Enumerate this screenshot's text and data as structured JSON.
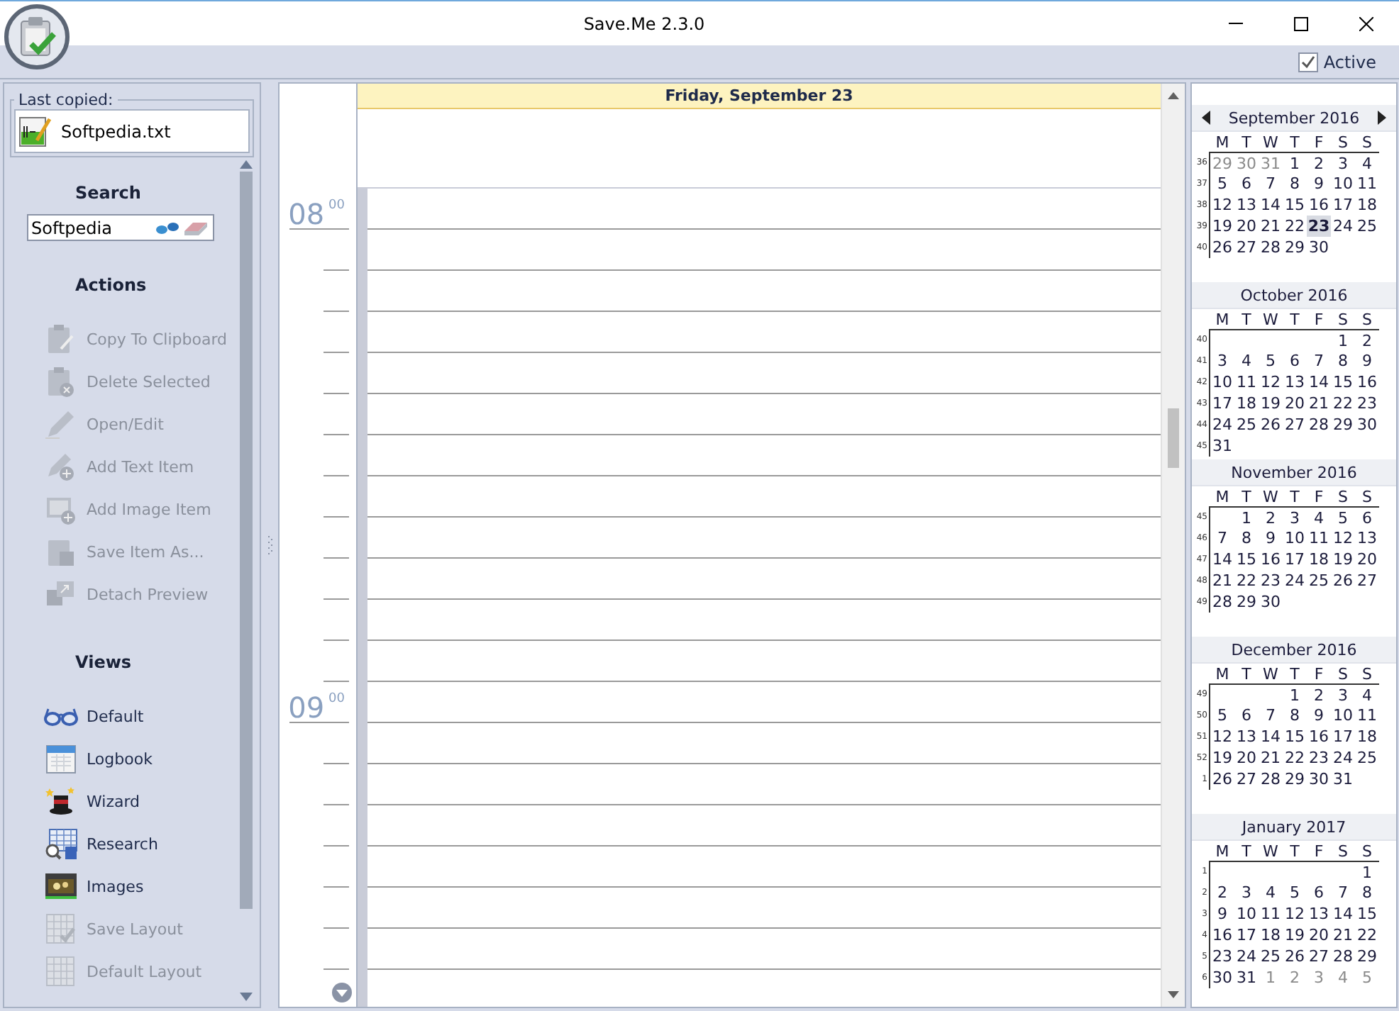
{
  "window": {
    "title": "Save.Me 2.3.0"
  },
  "toolbar": {
    "active": {
      "label": "Active",
      "checked": true
    }
  },
  "last_copied": {
    "label": "Last copied:",
    "file": "Softpedia.txt"
  },
  "sidebar": {
    "search": {
      "heading": "Search",
      "value": "Softpedia"
    },
    "sections": [
      {
        "heading": "Actions",
        "items": [
          {
            "label": "Copy To Clipboard",
            "disabled": true
          },
          {
            "label": "Delete Selected",
            "disabled": true
          },
          {
            "label": "Open/Edit",
            "disabled": true
          },
          {
            "label": "Add Text Item",
            "disabled": true
          },
          {
            "label": "Add Image Item",
            "disabled": true
          },
          {
            "label": "Save Item As...",
            "disabled": true
          },
          {
            "label": "Detach Preview",
            "disabled": true
          }
        ]
      },
      {
        "heading": "Views",
        "items": [
          {
            "label": "Default",
            "disabled": false
          },
          {
            "label": "Logbook",
            "disabled": false
          },
          {
            "label": "Wizard",
            "disabled": false
          },
          {
            "label": "Research",
            "disabled": false
          },
          {
            "label": "Images",
            "disabled": false
          },
          {
            "label": "Save Layout",
            "disabled": true
          },
          {
            "label": "Default Layout",
            "disabled": true
          }
        ]
      }
    ]
  },
  "day_view": {
    "header": "Friday, September 23",
    "hours": [
      {
        "hour": "08",
        "minutes": "00"
      },
      {
        "hour": "09",
        "minutes": "00"
      }
    ]
  },
  "calendar": {
    "months": [
      {
        "title": "September 2016",
        "weekdays": [
          "M",
          "T",
          "W",
          "T",
          "F",
          "S",
          "S"
        ],
        "weeks": [
          {
            "week": "36",
            "days": [
              {
                "day": "29",
                "muted": true,
                "selected": false
              },
              {
                "day": "30",
                "muted": true,
                "selected": false
              },
              {
                "day": "31",
                "muted": true,
                "selected": false
              },
              {
                "day": "1",
                "muted": false,
                "selected": false
              },
              {
                "day": "2",
                "muted": false,
                "selected": false
              },
              {
                "day": "3",
                "muted": false,
                "selected": false
              },
              {
                "day": "4",
                "muted": false,
                "selected": false
              }
            ]
          },
          {
            "week": "37",
            "days": [
              {
                "day": "5",
                "muted": false,
                "selected": false
              },
              {
                "day": "6",
                "muted": false,
                "selected": false
              },
              {
                "day": "7",
                "muted": false,
                "selected": false
              },
              {
                "day": "8",
                "muted": false,
                "selected": false
              },
              {
                "day": "9",
                "muted": false,
                "selected": false
              },
              {
                "day": "10",
                "muted": false,
                "selected": false
              },
              {
                "day": "11",
                "muted": false,
                "selected": false
              }
            ]
          },
          {
            "week": "38",
            "days": [
              {
                "day": "12",
                "muted": false,
                "selected": false
              },
              {
                "day": "13",
                "muted": false,
                "selected": false
              },
              {
                "day": "14",
                "muted": false,
                "selected": false
              },
              {
                "day": "15",
                "muted": false,
                "selected": false
              },
              {
                "day": "16",
                "muted": false,
                "selected": false
              },
              {
                "day": "17",
                "muted": false,
                "selected": false
              },
              {
                "day": "18",
                "muted": false,
                "selected": false
              }
            ]
          },
          {
            "week": "39",
            "days": [
              {
                "day": "19",
                "muted": false,
                "selected": false
              },
              {
                "day": "20",
                "muted": false,
                "selected": false
              },
              {
                "day": "21",
                "muted": false,
                "selected": false
              },
              {
                "day": "22",
                "muted": false,
                "selected": false
              },
              {
                "day": "23",
                "muted": false,
                "selected": true
              },
              {
                "day": "24",
                "muted": false,
                "selected": false
              },
              {
                "day": "25",
                "muted": false,
                "selected": false
              }
            ]
          },
          {
            "week": "40",
            "days": [
              {
                "day": "26",
                "muted": false,
                "selected": false
              },
              {
                "day": "27",
                "muted": false,
                "selected": false
              },
              {
                "day": "28",
                "muted": false,
                "selected": false
              },
              {
                "day": "29",
                "muted": false,
                "selected": false
              },
              {
                "day": "30",
                "muted": false,
                "selected": false
              }
            ]
          }
        ]
      },
      {
        "title": "October 2016",
        "weekdays": [
          "M",
          "T",
          "W",
          "T",
          "F",
          "S",
          "S"
        ],
        "weeks": [
          {
            "week": "40",
            "days": [
              {
                "day": "1",
                "muted": false,
                "selected": false
              },
              {
                "day": "2",
                "muted": false,
                "selected": false
              }
            ]
          },
          {
            "week": "41",
            "days": [
              {
                "day": "3",
                "muted": false,
                "selected": false
              },
              {
                "day": "4",
                "muted": false,
                "selected": false
              },
              {
                "day": "5",
                "muted": false,
                "selected": false
              },
              {
                "day": "6",
                "muted": false,
                "selected": false
              },
              {
                "day": "7",
                "muted": false,
                "selected": false
              },
              {
                "day": "8",
                "muted": false,
                "selected": false
              },
              {
                "day": "9",
                "muted": false,
                "selected": false
              }
            ]
          },
          {
            "week": "42",
            "days": [
              {
                "day": "10",
                "muted": false,
                "selected": false
              },
              {
                "day": "11",
                "muted": false,
                "selected": false
              },
              {
                "day": "12",
                "muted": false,
                "selected": false
              },
              {
                "day": "13",
                "muted": false,
                "selected": false
              },
              {
                "day": "14",
                "muted": false,
                "selected": false
              },
              {
                "day": "15",
                "muted": false,
                "selected": false
              },
              {
                "day": "16",
                "muted": false,
                "selected": false
              }
            ]
          },
          {
            "week": "43",
            "days": [
              {
                "day": "17",
                "muted": false,
                "selected": false
              },
              {
                "day": "18",
                "muted": false,
                "selected": false
              },
              {
                "day": "19",
                "muted": false,
                "selected": false
              },
              {
                "day": "20",
                "muted": false,
                "selected": false
              },
              {
                "day": "21",
                "muted": false,
                "selected": false
              },
              {
                "day": "22",
                "muted": false,
                "selected": false
              },
              {
                "day": "23",
                "muted": false,
                "selected": false
              }
            ]
          },
          {
            "week": "44",
            "days": [
              {
                "day": "24",
                "muted": false,
                "selected": false
              },
              {
                "day": "25",
                "muted": false,
                "selected": false
              },
              {
                "day": "26",
                "muted": false,
                "selected": false
              },
              {
                "day": "27",
                "muted": false,
                "selected": false
              },
              {
                "day": "28",
                "muted": false,
                "selected": false
              },
              {
                "day": "29",
                "muted": false,
                "selected": false
              },
              {
                "day": "30",
                "muted": false,
                "selected": false
              }
            ]
          },
          {
            "week": "45",
            "days": [
              {
                "day": "31",
                "muted": false,
                "selected": false
              }
            ]
          }
        ]
      },
      {
        "title": "November 2016",
        "weekdays": [
          "M",
          "T",
          "W",
          "T",
          "F",
          "S",
          "S"
        ],
        "weeks": [
          {
            "week": "45",
            "days": [
              {
                "day": "1",
                "muted": false,
                "selected": false
              },
              {
                "day": "2",
                "muted": false,
                "selected": false
              },
              {
                "day": "3",
                "muted": false,
                "selected": false
              },
              {
                "day": "4",
                "muted": false,
                "selected": false
              },
              {
                "day": "5",
                "muted": false,
                "selected": false
              },
              {
                "day": "6",
                "muted": false,
                "selected": false
              }
            ]
          },
          {
            "week": "46",
            "days": [
              {
                "day": "7",
                "muted": false,
                "selected": false
              },
              {
                "day": "8",
                "muted": false,
                "selected": false
              },
              {
                "day": "9",
                "muted": false,
                "selected": false
              },
              {
                "day": "10",
                "muted": false,
                "selected": false
              },
              {
                "day": "11",
                "muted": false,
                "selected": false
              },
              {
                "day": "12",
                "muted": false,
                "selected": false
              },
              {
                "day": "13",
                "muted": false,
                "selected": false
              }
            ]
          },
          {
            "week": "47",
            "days": [
              {
                "day": "14",
                "muted": false,
                "selected": false
              },
              {
                "day": "15",
                "muted": false,
                "selected": false
              },
              {
                "day": "16",
                "muted": false,
                "selected": false
              },
              {
                "day": "17",
                "muted": false,
                "selected": false
              },
              {
                "day": "18",
                "muted": false,
                "selected": false
              },
              {
                "day": "19",
                "muted": false,
                "selected": false
              },
              {
                "day": "20",
                "muted": false,
                "selected": false
              }
            ]
          },
          {
            "week": "48",
            "days": [
              {
                "day": "21",
                "muted": false,
                "selected": false
              },
              {
                "day": "22",
                "muted": false,
                "selected": false
              },
              {
                "day": "23",
                "muted": false,
                "selected": false
              },
              {
                "day": "24",
                "muted": false,
                "selected": false
              },
              {
                "day": "25",
                "muted": false,
                "selected": false
              },
              {
                "day": "26",
                "muted": false,
                "selected": false
              },
              {
                "day": "27",
                "muted": false,
                "selected": false
              }
            ]
          },
          {
            "week": "49",
            "days": [
              {
                "day": "28",
                "muted": false,
                "selected": false
              },
              {
                "day": "29",
                "muted": false,
                "selected": false
              },
              {
                "day": "30",
                "muted": false,
                "selected": false
              }
            ]
          }
        ]
      },
      {
        "title": "December 2016",
        "weekdays": [
          "M",
          "T",
          "W",
          "T",
          "F",
          "S",
          "S"
        ],
        "weeks": [
          {
            "week": "49",
            "days": [
              {
                "day": "1",
                "muted": false,
                "selected": false
              },
              {
                "day": "2",
                "muted": false,
                "selected": false
              },
              {
                "day": "3",
                "muted": false,
                "selected": false
              },
              {
                "day": "4",
                "muted": false,
                "selected": false
              }
            ]
          },
          {
            "week": "50",
            "days": [
              {
                "day": "5",
                "muted": false,
                "selected": false
              },
              {
                "day": "6",
                "muted": false,
                "selected": false
              },
              {
                "day": "7",
                "muted": false,
                "selected": false
              },
              {
                "day": "8",
                "muted": false,
                "selected": false
              },
              {
                "day": "9",
                "muted": false,
                "selected": false
              },
              {
                "day": "10",
                "muted": false,
                "selected": false
              },
              {
                "day": "11",
                "muted": false,
                "selected": false
              }
            ]
          },
          {
            "week": "51",
            "days": [
              {
                "day": "12",
                "muted": false,
                "selected": false
              },
              {
                "day": "13",
                "muted": false,
                "selected": false
              },
              {
                "day": "14",
                "muted": false,
                "selected": false
              },
              {
                "day": "15",
                "muted": false,
                "selected": false
              },
              {
                "day": "16",
                "muted": false,
                "selected": false
              },
              {
                "day": "17",
                "muted": false,
                "selected": false
              },
              {
                "day": "18",
                "muted": false,
                "selected": false
              }
            ]
          },
          {
            "week": "52",
            "days": [
              {
                "day": "19",
                "muted": false,
                "selected": false
              },
              {
                "day": "20",
                "muted": false,
                "selected": false
              },
              {
                "day": "21",
                "muted": false,
                "selected": false
              },
              {
                "day": "22",
                "muted": false,
                "selected": false
              },
              {
                "day": "23",
                "muted": false,
                "selected": false
              },
              {
                "day": "24",
                "muted": false,
                "selected": false
              },
              {
                "day": "25",
                "muted": false,
                "selected": false
              }
            ]
          },
          {
            "week": "1",
            "days": [
              {
                "day": "26",
                "muted": false,
                "selected": false
              },
              {
                "day": "27",
                "muted": false,
                "selected": false
              },
              {
                "day": "28",
                "muted": false,
                "selected": false
              },
              {
                "day": "29",
                "muted": false,
                "selected": false
              },
              {
                "day": "30",
                "muted": false,
                "selected": false
              },
              {
                "day": "31",
                "muted": false,
                "selected": false
              }
            ]
          }
        ]
      },
      {
        "title": "January 2017",
        "weekdays": [
          "M",
          "T",
          "W",
          "T",
          "F",
          "S",
          "S"
        ],
        "weeks": [
          {
            "week": "1",
            "days": [
              {
                "day": "1",
                "muted": false,
                "selected": false
              }
            ]
          },
          {
            "week": "2",
            "days": [
              {
                "day": "2",
                "muted": false,
                "selected": false
              },
              {
                "day": "3",
                "muted": false,
                "selected": false
              },
              {
                "day": "4",
                "muted": false,
                "selected": false
              },
              {
                "day": "5",
                "muted": false,
                "selected": false
              },
              {
                "day": "6",
                "muted": false,
                "selected": false
              },
              {
                "day": "7",
                "muted": false,
                "selected": false
              },
              {
                "day": "8",
                "muted": false,
                "selected": false
              }
            ]
          },
          {
            "week": "3",
            "days": [
              {
                "day": "9",
                "muted": false,
                "selected": false
              },
              {
                "day": "10",
                "muted": false,
                "selected": false
              },
              {
                "day": "11",
                "muted": false,
                "selected": false
              },
              {
                "day": "12",
                "muted": false,
                "selected": false
              },
              {
                "day": "13",
                "muted": false,
                "selected": false
              },
              {
                "day": "14",
                "muted": false,
                "selected": false
              },
              {
                "day": "15",
                "muted": false,
                "selected": false
              }
            ]
          },
          {
            "week": "4",
            "days": [
              {
                "day": "16",
                "muted": false,
                "selected": false
              },
              {
                "day": "17",
                "muted": false,
                "selected": false
              },
              {
                "day": "18",
                "muted": false,
                "selected": false
              },
              {
                "day": "19",
                "muted": false,
                "selected": false
              },
              {
                "day": "20",
                "muted": false,
                "selected": false
              },
              {
                "day": "21",
                "muted": false,
                "selected": false
              },
              {
                "day": "22",
                "muted": false,
                "selected": false
              }
            ]
          },
          {
            "week": "5",
            "days": [
              {
                "day": "23",
                "muted": false,
                "selected": false
              },
              {
                "day": "24",
                "muted": false,
                "selected": false
              },
              {
                "day": "25",
                "muted": false,
                "selected": false
              },
              {
                "day": "26",
                "muted": false,
                "selected": false
              },
              {
                "day": "27",
                "muted": false,
                "selected": false
              },
              {
                "day": "28",
                "muted": false,
                "selected": false
              },
              {
                "day": "29",
                "muted": false,
                "selected": false
              }
            ]
          },
          {
            "week": "6",
            "days": [
              {
                "day": "30",
                "muted": false,
                "selected": false
              },
              {
                "day": "31",
                "muted": false,
                "selected": false
              },
              {
                "day": "1",
                "muted": true,
                "selected": false
              },
              {
                "day": "2",
                "muted": true,
                "selected": false
              },
              {
                "day": "3",
                "muted": true,
                "selected": false
              },
              {
                "day": "4",
                "muted": true,
                "selected": false
              },
              {
                "day": "5",
                "muted": true,
                "selected": false
              }
            ]
          }
        ]
      }
    ]
  }
}
